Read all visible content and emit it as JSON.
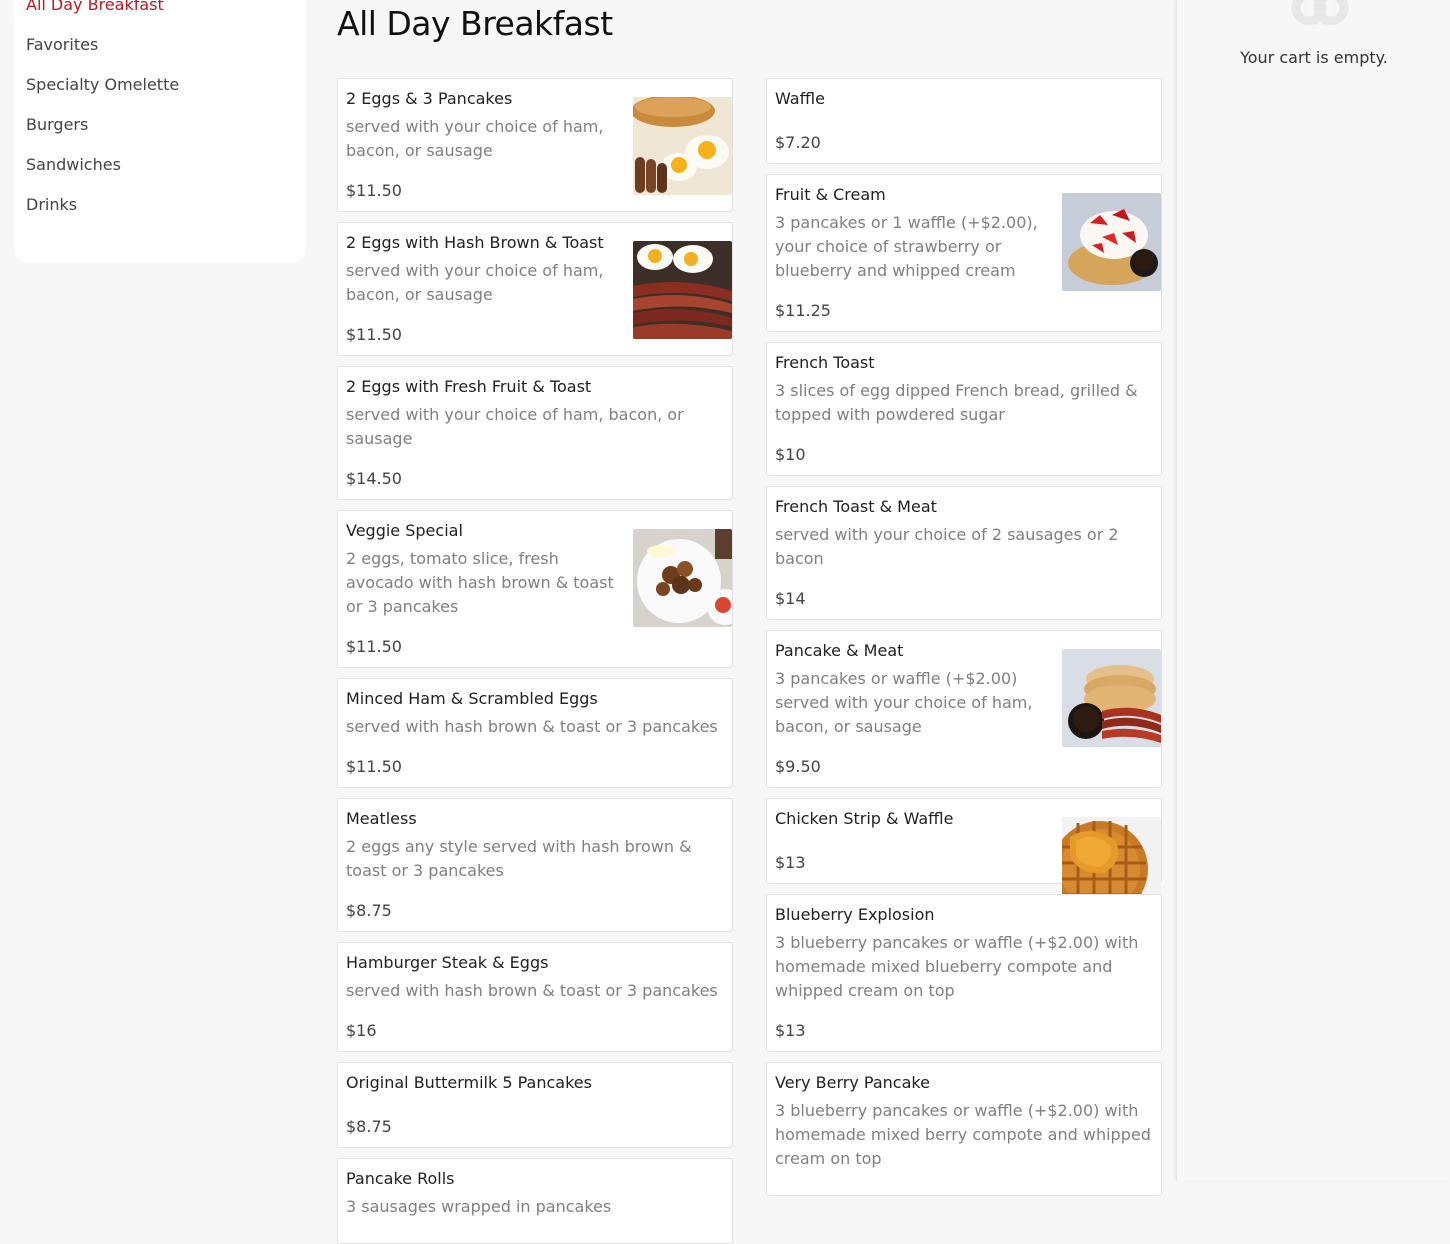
{
  "sidebar": {
    "categories": [
      {
        "label": "All Day Breakfast",
        "active": true
      },
      {
        "label": "Favorites"
      },
      {
        "label": "Specialty Omelette"
      },
      {
        "label": "Burgers"
      },
      {
        "label": "Sandwiches"
      },
      {
        "label": "Drinks"
      }
    ]
  },
  "main": {
    "title": "All Day Breakfast",
    "left_items": [
      {
        "name": "2 Eggs & 3 Pancakes",
        "desc": "served with your choice of ham, bacon, or sausage",
        "price": "$11.50",
        "image": "eggs-pancakes-photo"
      },
      {
        "name": "2 Eggs with Hash Brown & Toast",
        "desc": "served with your choice of ham, bacon, or sausage",
        "price": "$11.50",
        "image": "eggs-bacon-photo"
      },
      {
        "name": "2 Eggs with Fresh Fruit & Toast",
        "desc": "served with your choice of ham, bacon, or sausage",
        "price": "$14.50"
      },
      {
        "name": "Veggie Special",
        "desc": "2 eggs, tomato slice, fresh avocado with hash brown & toast or 3 pancakes",
        "price": "$11.50",
        "image": "veggie-plate-photo"
      },
      {
        "name": "Minced Ham & Scrambled Eggs",
        "desc": "served with hash brown & toast or 3 pancakes",
        "price": "$11.50"
      },
      {
        "name": "Meatless",
        "desc": "2 eggs any style served with hash brown & toast or 3 pancakes",
        "price": "$8.75"
      },
      {
        "name": "Hamburger Steak & Eggs",
        "desc": "served with hash brown & toast or 3 pancakes",
        "price": "$16"
      },
      {
        "name": "Original Buttermilk 5 Pancakes",
        "desc": "",
        "price": "$8.75"
      },
      {
        "name": "Pancake Rolls",
        "desc": "3 sausages wrapped in pancakes",
        "price": ""
      }
    ],
    "right_items": [
      {
        "name": "Waffle",
        "desc": "",
        "price": "$7.20"
      },
      {
        "name": "Fruit & Cream",
        "desc": "3 pancakes or 1 waffle (+$2.00), your choice of strawberry or blueberry and whipped cream",
        "price": "$11.25",
        "image": "strawberry-cream-photo"
      },
      {
        "name": "French Toast",
        "desc": "3 slices of egg dipped French bread, grilled & topped with powdered sugar",
        "price": "$10"
      },
      {
        "name": "French Toast & Meat",
        "desc": "served with your choice of 2 sausages or 2 bacon",
        "price": "$14"
      },
      {
        "name": "Pancake & Meat",
        "desc": "3 pancakes or waffle (+$2.00) served with your choice of ham, bacon, or sausage",
        "price": "$9.50",
        "image": "pancake-bacon-photo"
      },
      {
        "name": "Chicken Strip & Waffle",
        "desc": "",
        "price": "$13",
        "image": "chicken-waffle-photo"
      },
      {
        "name": "Blueberry Explosion",
        "desc": "3 blueberry pancakes or waffle (+$2.00) with homemade mixed blueberry compote and whipped cream on top",
        "price": "$13"
      },
      {
        "name": "Very Berry Pancake",
        "desc": "3 blueberry pancakes or waffle (+$2.00) with homemade mixed berry compote and whipped cream on top",
        "price": ""
      }
    ]
  },
  "cart": {
    "empty_text": "Your cart is empty.",
    "icon": "cart-icon"
  },
  "colors": {
    "accent": "#c0171f",
    "background": "#f7f7f7",
    "card": "#ffffff",
    "muted_text": "#808080"
  }
}
